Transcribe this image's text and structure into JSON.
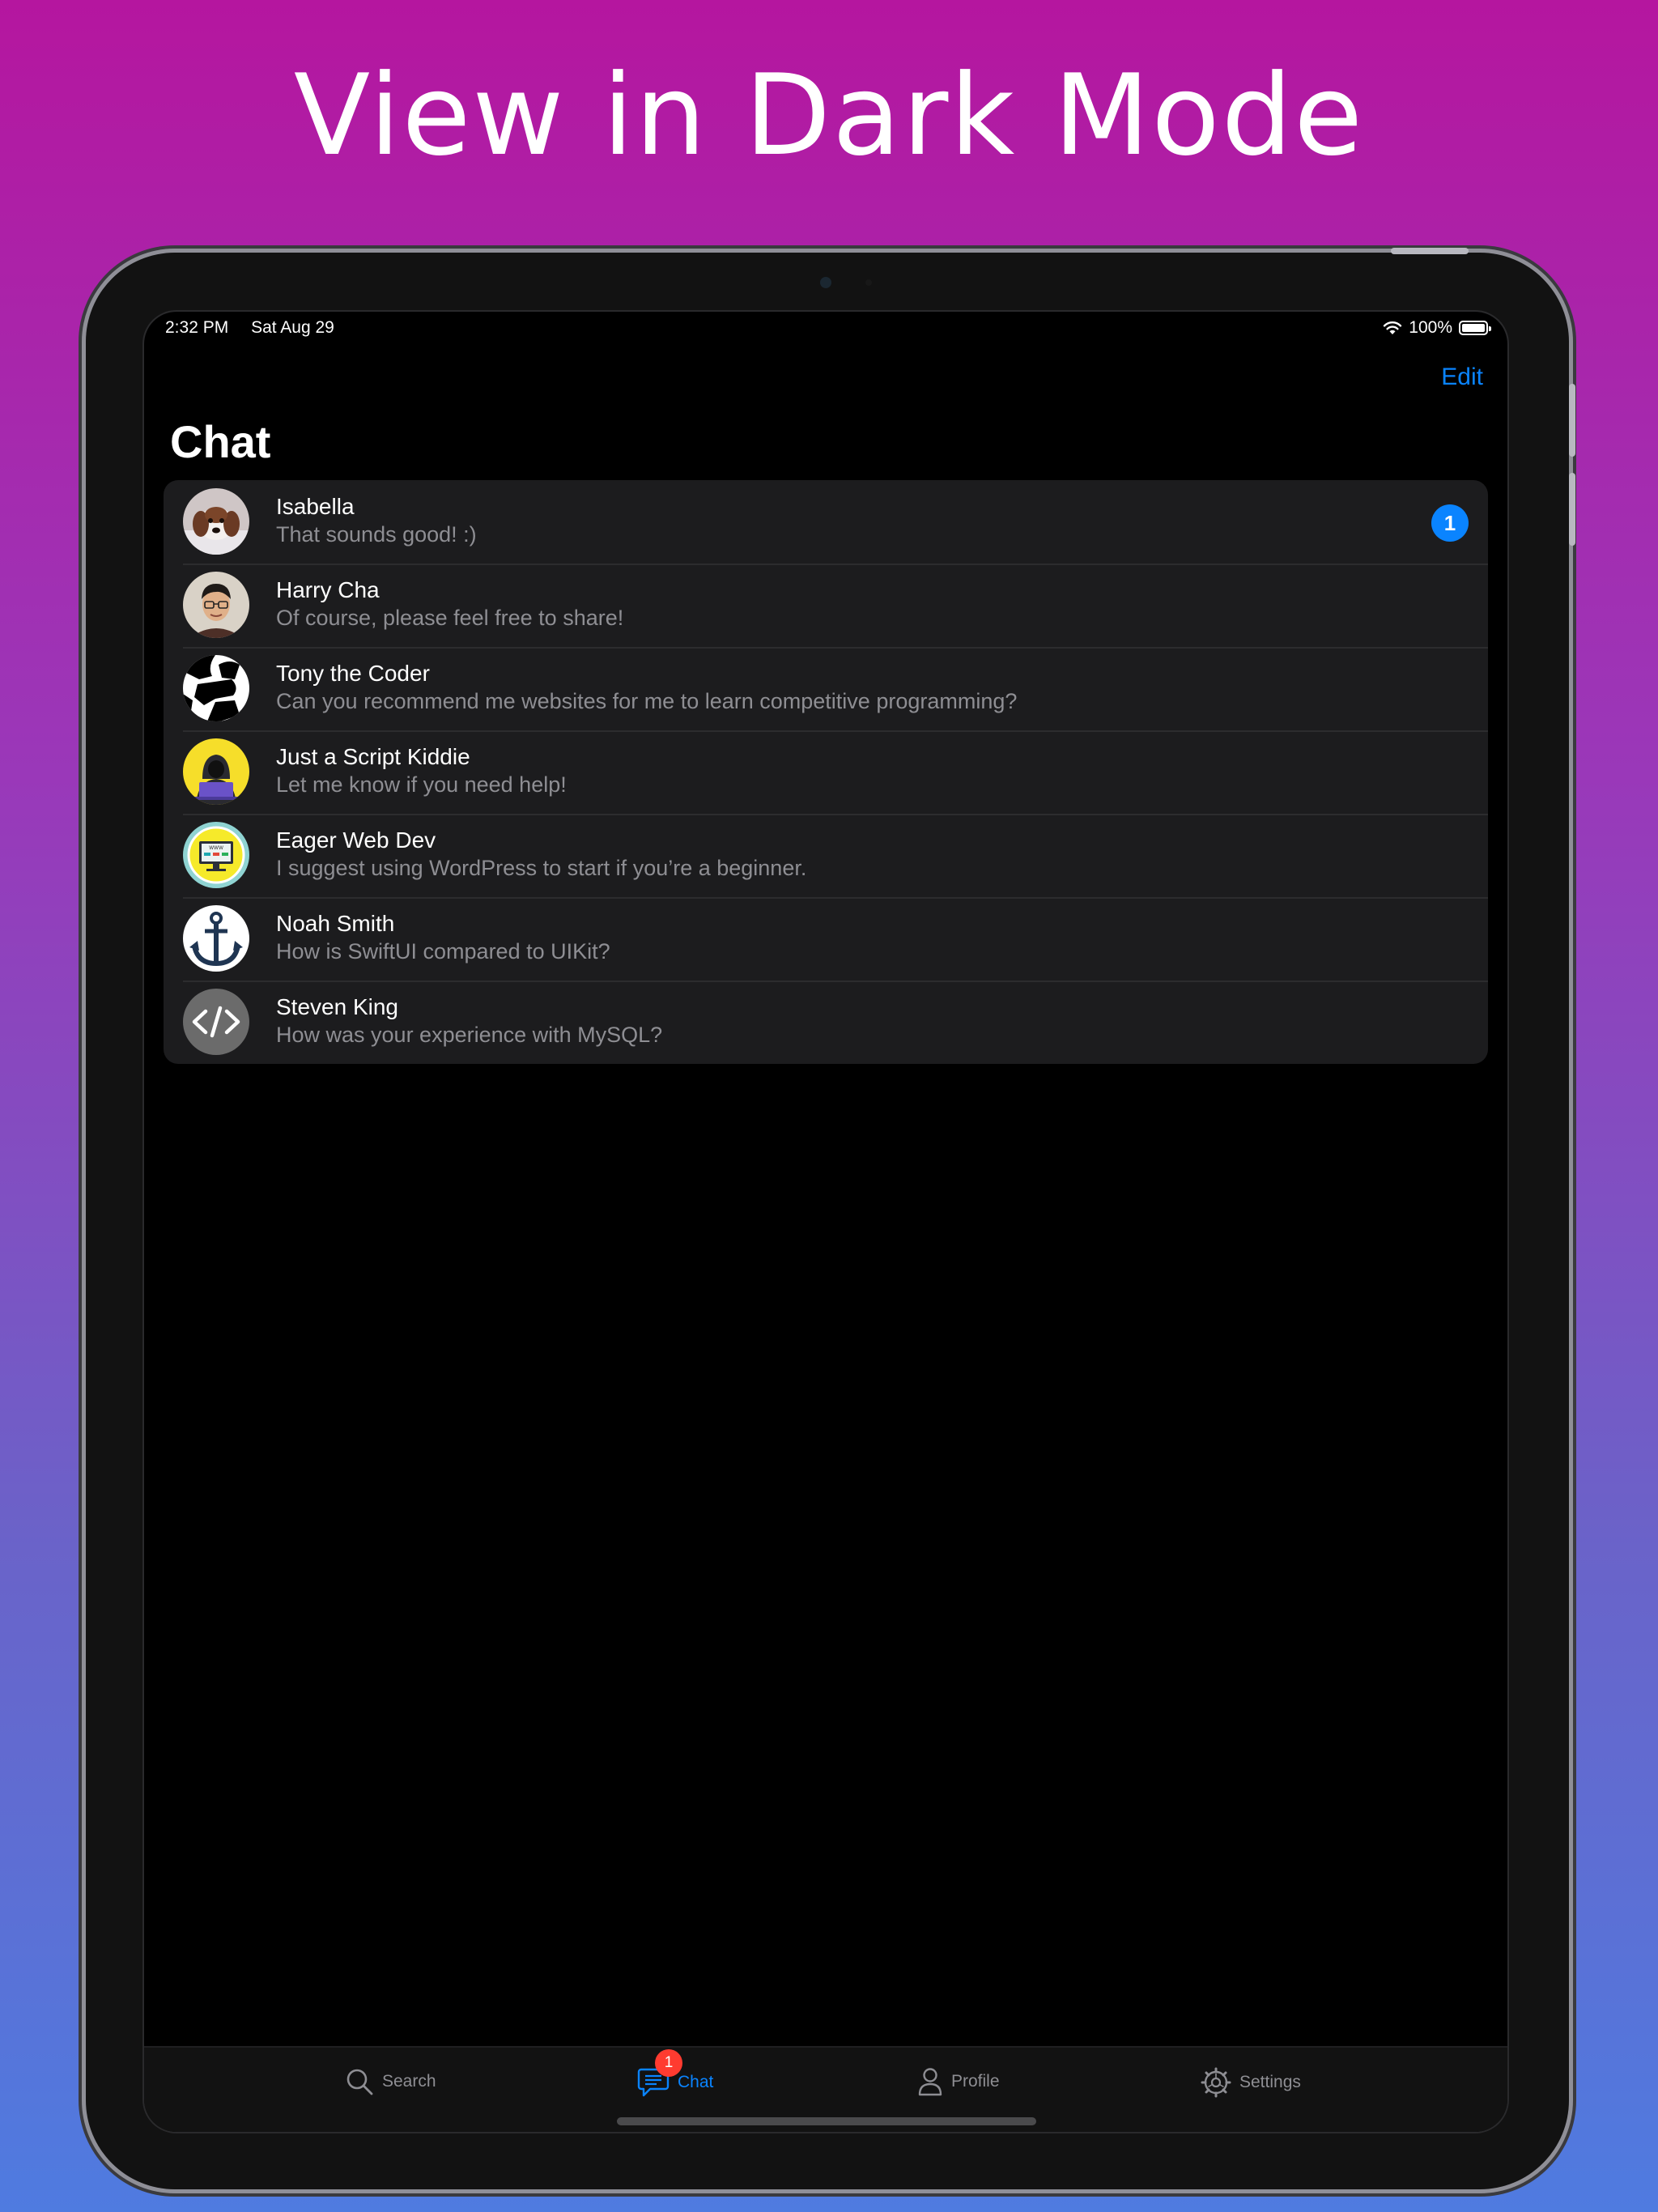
{
  "promo": {
    "title": "View in Dark Mode"
  },
  "status_bar": {
    "time": "2:32 PM",
    "date": "Sat Aug 29",
    "battery": "100%",
    "battery_level": 1.0
  },
  "nav": {
    "edit_label": "Edit",
    "title": "Chat"
  },
  "chats": [
    {
      "name": "Isabella",
      "preview": "That sounds good!  :)",
      "unread": "1",
      "avatar_icon": "puppy-photo-avatar"
    },
    {
      "name": "Harry Cha",
      "preview": "Of course, please feel free to share!",
      "avatar_icon": "man-with-glasses-photo-avatar"
    },
    {
      "name": "Tony the Coder",
      "preview": "Can you recommend me websites for me to learn competitive programming?",
      "avatar_icon": "coder-silhouette-avatar"
    },
    {
      "name": "Just a Script Kiddie",
      "preview": "Let me know if you need help!",
      "avatar_icon": "hooded-hacker-avatar"
    },
    {
      "name": "Eager Web Dev",
      "preview": "I suggest using WordPress to start if you’re a beginner.",
      "avatar_icon": "www-monitor-avatar"
    },
    {
      "name": "Noah Smith",
      "preview": "How is SwiftUI compared to UIKit?",
      "avatar_icon": "anchor-avatar"
    },
    {
      "name": "Steven King",
      "preview": "How was your experience with MySQL?",
      "avatar_icon": "code-brackets-avatar"
    }
  ],
  "tabs": [
    {
      "label": "Search",
      "icon": "magnifying-glass-icon"
    },
    {
      "label": "Chat",
      "icon": "chat-bubble-icon",
      "badge": "1",
      "active": true
    },
    {
      "label": "Profile",
      "icon": "person-icon"
    },
    {
      "label": "Settings",
      "icon": "gear-icon"
    }
  ],
  "colors": {
    "accent": "#0a84ff",
    "badge_red": "#ff3b30",
    "background_gradient_top": "#b5169f",
    "background_gradient_bottom": "#4f7be0",
    "cell_background": "#1c1c1e",
    "secondary_text": "#8e8e93"
  }
}
